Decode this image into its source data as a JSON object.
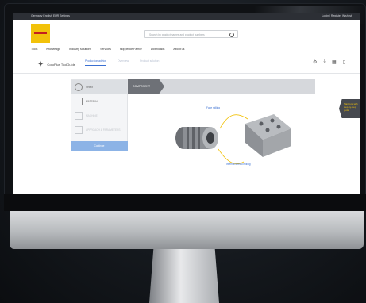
{
  "topbar": {
    "left_text": "Germany English EUR Settings",
    "right_text": "Login / Register Wishlist"
  },
  "search": {
    "placeholder": "Search by product names and product numbers"
  },
  "nav": {
    "items": [
      "Tools",
      "Knowledge",
      "Industry solutions",
      "Services",
      "Hoppecke Family",
      "Downloads",
      "About us"
    ]
  },
  "product": {
    "title": "CoroPlus ToolGuide"
  },
  "tabs": [
    {
      "label": "Production advice",
      "active": true
    },
    {
      "label": "Overview",
      "active": false
    },
    {
      "label": "Product solution",
      "active": false
    }
  ],
  "panel": {
    "rows": [
      {
        "label": "Select",
        "state": "selected"
      },
      {
        "label": "MATERIAL",
        "state": "normal"
      },
      {
        "label": "MACHINE",
        "state": "faint"
      },
      {
        "label": "APPROACH & PARAMETERS",
        "state": "faint"
      }
    ],
    "button_label": "Continue"
  },
  "step": {
    "label": "COMPONENT"
  },
  "diagram": {
    "label_top": "Face milling",
    "label_bottom": "Internal thread milling"
  },
  "right_tag": {
    "text": "Start now with step-by-step guide"
  },
  "colors": {
    "accent_yellow": "#f2c20a",
    "link_blue": "#3a6fd1",
    "button_blue": "#8cb3e6"
  }
}
